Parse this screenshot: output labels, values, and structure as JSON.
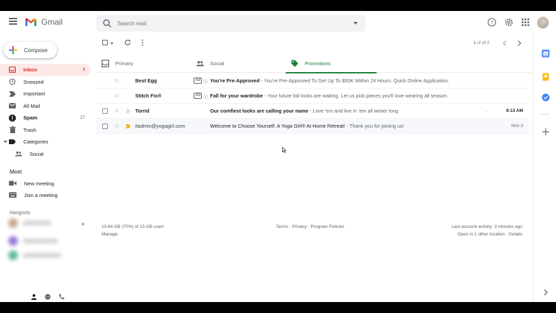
{
  "header": {
    "app_name": "Gmail",
    "search_placeholder": "Search mail",
    "icons": [
      "menu-icon",
      "help-icon",
      "settings-icon",
      "apps-icon",
      "avatar"
    ]
  },
  "compose_label": "Compose",
  "nav": {
    "items": [
      {
        "label": "Inbox",
        "count": "1",
        "icon": "inbox-icon",
        "active": true
      },
      {
        "label": "Snoozed",
        "count": "",
        "icon": "clock-icon"
      },
      {
        "label": "Important",
        "count": "",
        "icon": "important-icon"
      },
      {
        "label": "All Mail",
        "count": "",
        "icon": "mail-icon"
      },
      {
        "label": "Spam",
        "count": "27",
        "icon": "spam-icon",
        "bold": true
      },
      {
        "label": "Trash",
        "count": "",
        "icon": "trash-icon"
      },
      {
        "label": "Categories",
        "count": "",
        "icon": "label-icon"
      },
      {
        "label": "Social",
        "count": "",
        "icon": "people-icon"
      }
    ]
  },
  "meet": {
    "title": "Meet",
    "new_meeting": "New meeting",
    "join_meeting": "Join a meeting"
  },
  "hangouts": {
    "title": "Hangouts"
  },
  "toolbar": {
    "pager": "1–2 of 2"
  },
  "tabs": [
    {
      "label": "Primary",
      "icon": "inbox-tab-icon"
    },
    {
      "label": "Social",
      "icon": "people-icon"
    },
    {
      "label": "Promotions",
      "icon": "tag-icon",
      "active": true
    }
  ],
  "rows": [
    {
      "sender": "Best Egg",
      "ad": "Ad",
      "subject": "You're Pre-Approved",
      "snippet": " - You're Pre-Approved To Get Up To $50K Within 24 Hours. Quick Online Application.",
      "date": ""
    },
    {
      "sender": "Stitch Fix®",
      "ad": "Ad",
      "subject": "Fall for your wardrobe",
      "snippet": " - Your future fall looks are waiting. Let us pick pieces you'll love wearing all season.",
      "date": ""
    },
    {
      "sender": "Torrid",
      "ad": "",
      "subject": "Our comfiest looks are calling your name",
      "snippet": " - Love 'em and live in 'em all winter long",
      "date": "8:13 AM"
    },
    {
      "sender": "itadmin@yogagirl.com",
      "ad": "",
      "subject": "Welcome to Choose Yourself: A Yoga Girl® At Home Retreat!",
      "snippet": " - Thank you for joining us!",
      "date": "Nov 3"
    }
  ],
  "footer": {
    "storage": "10.64 GB (70%) of 15 GB used",
    "manage": "Manage",
    "links": "Terms · Privacy · Program Policies",
    "activity": "Last account activity: 3 minutes ago",
    "activity_detail": "Open in 1 other location · Details"
  },
  "colors": {
    "accent_red": "#d93025",
    "promotions_green": "#188038",
    "inbox_active_bg": "#fce8e6"
  }
}
